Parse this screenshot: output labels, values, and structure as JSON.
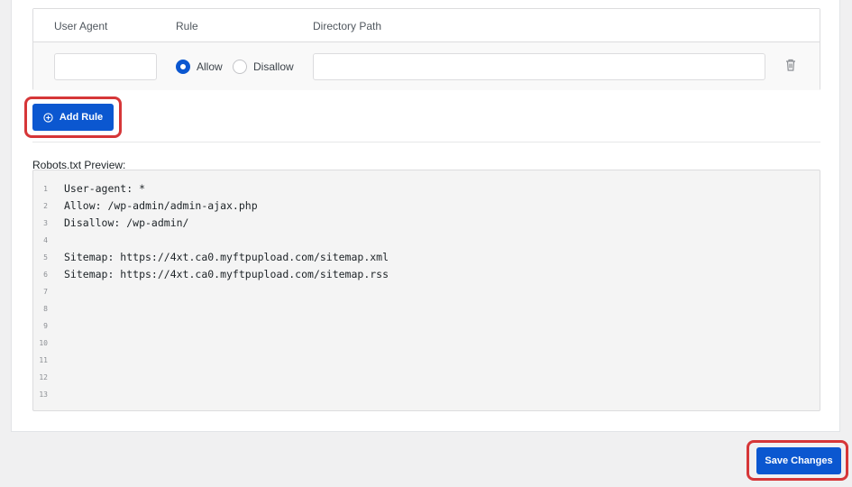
{
  "rules_table": {
    "headers": [
      "User Agent",
      "Rule",
      "Directory Path"
    ],
    "row": {
      "user_agent_value": "",
      "rule_selected": "Allow",
      "rule_options": [
        "Allow",
        "Disallow"
      ],
      "path_value": ""
    }
  },
  "add_rule_label": "Add Rule",
  "preview_title": "Robots.txt Preview:",
  "preview_lines": [
    {
      "num": "1",
      "text": "User-agent: *"
    },
    {
      "num": "2",
      "text": "Allow: /wp-admin/admin-ajax.php"
    },
    {
      "num": "3",
      "text": "Disallow: /wp-admin/"
    },
    {
      "num": "4",
      "text": ""
    },
    {
      "num": "5",
      "text": "Sitemap: https://4xt.ca0.myftpupload.com/sitemap.xml"
    },
    {
      "num": "6",
      "text": "Sitemap: https://4xt.ca0.myftpupload.com/sitemap.rss"
    },
    {
      "num": "7",
      "text": ""
    },
    {
      "num": "8",
      "text": ""
    },
    {
      "num": "9",
      "text": ""
    },
    {
      "num": "10",
      "text": ""
    },
    {
      "num": "11",
      "text": ""
    },
    {
      "num": "12",
      "text": ""
    },
    {
      "num": "13",
      "text": ""
    }
  ],
  "save_label": "Save Changes",
  "colors": {
    "primary": "#0b57d0",
    "highlight": "#d63638"
  }
}
